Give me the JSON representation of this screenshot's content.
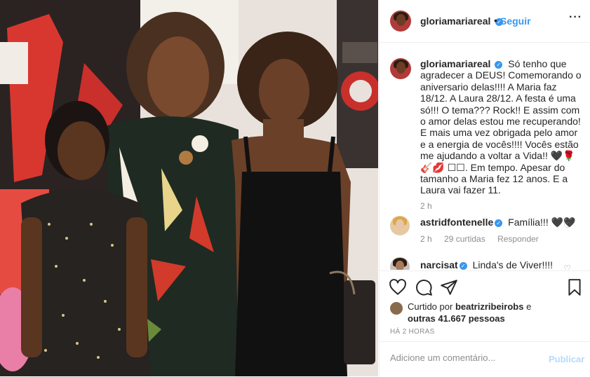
{
  "post": {
    "username": "gloriamariareal",
    "verified_mark": "✓",
    "separator": "•",
    "follow_label": "Seguir",
    "more_label": "···"
  },
  "caption": {
    "username": "gloriamariareal",
    "text": "Só tenho que agradecer a DEUS! Comemorando o aniversario delas!!!! A Maria faz 18/12. A Laura 28/12. A festa é uma só!!! O tema??? Rock!! E assim com o amor delas estou me recuperando! E mais uma vez obrigada pelo amor e a energia de vocês!!!! Vocês estão me ajudando a voltar a Vida!! 🖤🌹🎸💋 ☐☐. Em tempo. Apesar do tamanho a Maria fez 12 anos. E a Laura vai fazer 11.",
    "age": "2 h"
  },
  "comments": [
    {
      "username": "astridfontenelle",
      "text": "Família!!! 🖤🖤",
      "age": "2 h",
      "likes": "29 curtidas",
      "reply_label": "Responder"
    },
    {
      "username": "narcisat",
      "text": "Linda's de Viver!!!!"
    }
  ],
  "actions": {
    "like_icon": "heart-icon",
    "comment_icon": "comment-icon",
    "share_icon": "share-icon",
    "save_icon": "bookmark-icon"
  },
  "likes": {
    "prefix": "Curtido por",
    "user": "beatrizribeirobs",
    "connector": "e",
    "others": "outras 41.667 pessoas"
  },
  "timestamp": "HÁ 2 HORAS",
  "add_comment": {
    "placeholder": "Adicione um comentário...",
    "publish_label": "Publicar"
  },
  "colors": {
    "accent": "#3897f0",
    "publish_disabled": "#b3dbff",
    "muted": "#8e8e8e"
  }
}
